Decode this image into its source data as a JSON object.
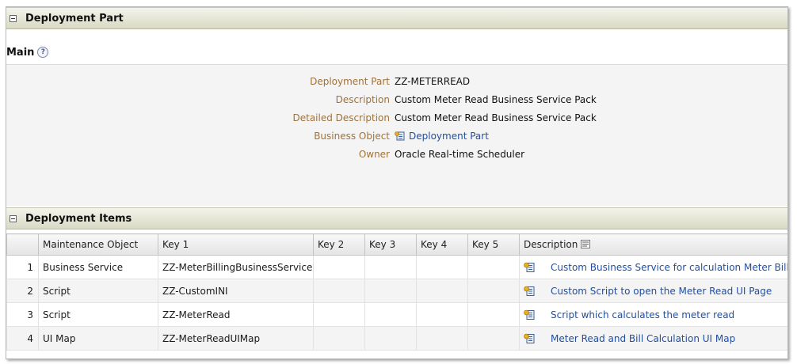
{
  "deployment_part_section": {
    "title": "Deployment Part"
  },
  "main": {
    "label": "Main",
    "help_glyph": "?",
    "fields": [
      {
        "label": "Deployment Part",
        "value": "ZZ-METERREAD"
      },
      {
        "label": "Description",
        "value": "Custom Meter Read Business Service Pack"
      },
      {
        "label": "Detailed Description",
        "value": "Custom Meter Read Business Service Pack"
      },
      {
        "label": "Business Object",
        "value": "Deployment Part",
        "icon": "business-object-icon",
        "link": true
      },
      {
        "label": "Owner",
        "value": "Oracle Real-time Scheduler"
      }
    ]
  },
  "deployment_items_section": {
    "title": "Deployment Items"
  },
  "items_table": {
    "headers": [
      "",
      "Maintenance Object",
      "Key 1",
      "Key 2",
      "Key 3",
      "Key 4",
      "Key 5",
      "Description"
    ],
    "rows": [
      {
        "num": "1",
        "mo": "Business Service",
        "key1": "ZZ-MeterBillingBusinessService",
        "key2": "",
        "key3": "",
        "key4": "",
        "key5": "",
        "description": "Custom Business Service for calculation Meter Bill"
      },
      {
        "num": "2",
        "mo": "Script",
        "key1": "ZZ-CustomINI",
        "key2": "",
        "key3": "",
        "key4": "",
        "key5": "",
        "description": "Custom Script to open the Meter Read UI Page"
      },
      {
        "num": "3",
        "mo": "Script",
        "key1": "ZZ-MeterRead",
        "key2": "",
        "key3": "",
        "key4": "",
        "key5": "",
        "description": "Script which calculates the meter read"
      },
      {
        "num": "4",
        "mo": "UI Map",
        "key1": "ZZ-MeterReadUIMap",
        "key2": "",
        "key3": "",
        "key4": "",
        "key5": "",
        "description": "Meter Read and Bill Calculation UI Map"
      }
    ]
  },
  "colors": {
    "label": "#a0723a",
    "link": "#1e4fa8",
    "header_bg": "#d9d9c4"
  }
}
